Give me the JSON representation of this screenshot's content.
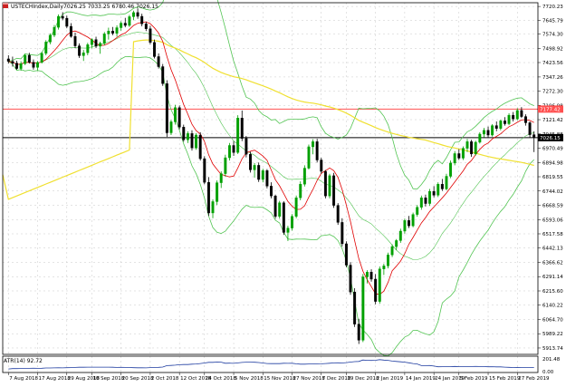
{
  "window": {
    "symbol_line": "USTECHIndex,Daily",
    "ohlc_line": "7026.25 7033.25 6780.46 7026.15"
  },
  "price_tags": {
    "resistance": "7177.42",
    "current": "7026.15"
  },
  "y_ticks": [
    "7720.23",
    "7645.79",
    "7574.30",
    "7498.92",
    "7423.56",
    "7347.26",
    "7272.30",
    "7196.98",
    "7121.42",
    "7045.88",
    "6970.49",
    "6894.98",
    "6819.55",
    "6744.02",
    "6668.59",
    "6593.06",
    "6517.58",
    "6442.13",
    "6366.62",
    "6291.14",
    "6215.60",
    "6140.22",
    "6064.70",
    "5989.22",
    "5913.74"
  ],
  "x_ticks": [
    "7 Aug 2018",
    "17 Aug 2018",
    "29 Aug 2018",
    "10 Sep 2018",
    "20 Sep 2018",
    "2 Oct 2018",
    "12 Oct 2018",
    "24 Oct 2018",
    "5 Nov 2018",
    "15 Nov 2018",
    "27 Nov 2018",
    "7 Dec 2018",
    "19 Dec 2018",
    "2 Jan 2019",
    "14 Jan 2019",
    "24 Jan 2019",
    "5 Feb 2019",
    "15 Feb 2019",
    "27 Feb 2019"
  ],
  "indicator": {
    "label": "ATR(14) 92.72",
    "ticks": [
      "201.48",
      "0.00"
    ]
  },
  "colors": {
    "bull": "#00a000",
    "bear": "#000000",
    "bollinger": "#52c452",
    "ma_fast": "#e00000",
    "ma_slow": "#f0e030",
    "resistance": "#ff5050",
    "current": "#000000",
    "grid": "#c8c8c8",
    "atr": "#1e3ca0"
  },
  "chart_data": {
    "type": "candlestick",
    "title": "USTECHIndex,Daily",
    "ylim": [
      5880,
      7740
    ],
    "candles": [
      [
        7443,
        7462,
        7418,
        7430
      ],
      [
        7430,
        7455,
        7402,
        7420
      ],
      [
        7420,
        7433,
        7385,
        7392
      ],
      [
        7392,
        7430,
        7380,
        7418
      ],
      [
        7418,
        7470,
        7410,
        7462
      ],
      [
        7462,
        7475,
        7418,
        7425
      ],
      [
        7425,
        7440,
        7386,
        7398
      ],
      [
        7398,
        7432,
        7382,
        7424
      ],
      [
        7424,
        7480,
        7418,
        7472
      ],
      [
        7472,
        7542,
        7462,
        7532
      ],
      [
        7532,
        7578,
        7520,
        7568
      ],
      [
        7568,
        7622,
        7558,
        7610
      ],
      [
        7610,
        7678,
        7598,
        7668
      ],
      [
        7668,
        7690,
        7648,
        7658
      ],
      [
        7658,
        7672,
        7605,
        7615
      ],
      [
        7615,
        7632,
        7555,
        7562
      ],
      [
        7562,
        7582,
        7500,
        7512
      ],
      [
        7512,
        7525,
        7448,
        7460
      ],
      [
        7460,
        7490,
        7432,
        7475
      ],
      [
        7475,
        7528,
        7462,
        7518
      ],
      [
        7518,
        7552,
        7498,
        7545
      ],
      [
        7545,
        7560,
        7500,
        7510
      ],
      [
        7510,
        7534,
        7470,
        7525
      ],
      [
        7525,
        7585,
        7515,
        7575
      ],
      [
        7575,
        7608,
        7545,
        7590
      ],
      [
        7590,
        7612,
        7568,
        7578
      ],
      [
        7578,
        7620,
        7560,
        7608
      ],
      [
        7608,
        7642,
        7592,
        7632
      ],
      [
        7632,
        7660,
        7610,
        7620
      ],
      [
        7620,
        7676,
        7612,
        7666
      ],
      [
        7666,
        7698,
        7648,
        7688
      ],
      [
        7688,
        7710,
        7655,
        7668
      ],
      [
        7668,
        7682,
        7615,
        7628
      ],
      [
        7628,
        7640,
        7590,
        7602
      ],
      [
        7602,
        7618,
        7520,
        7530
      ],
      [
        7530,
        7545,
        7445,
        7455
      ],
      [
        7455,
        7472,
        7392,
        7402
      ],
      [
        7402,
        7416,
        7300,
        7312
      ],
      [
        7312,
        7330,
        7030,
        7052
      ],
      [
        7052,
        7120,
        7040,
        7110
      ],
      [
        7110,
        7200,
        7095,
        7185
      ],
      [
        7185,
        7196,
        7070,
        7082
      ],
      [
        7082,
        7095,
        7005,
        7015
      ],
      [
        7015,
        7060,
        6998,
        7048
      ],
      [
        7048,
        7065,
        6958,
        6972
      ],
      [
        6972,
        7050,
        6962,
        7040
      ],
      [
        7040,
        7055,
        6905,
        6915
      ],
      [
        6915,
        6928,
        6780,
        6790
      ],
      [
        6790,
        6818,
        6612,
        6628
      ],
      [
        6628,
        6700,
        6600,
        6688
      ],
      [
        6688,
        6800,
        6670,
        6788
      ],
      [
        6788,
        6848,
        6760,
        6836
      ],
      [
        6836,
        6936,
        6820,
        6920
      ],
      [
        6920,
        6998,
        6905,
        6985
      ],
      [
        6985,
        7008,
        6930,
        6948
      ],
      [
        6948,
        7145,
        6940,
        7130
      ],
      [
        7130,
        7170,
        7008,
        7022
      ],
      [
        7022,
        7035,
        6922,
        6938
      ],
      [
        6938,
        6952,
        6842,
        6856
      ],
      [
        6856,
        6892,
        6815,
        6880
      ],
      [
        6880,
        6895,
        6792,
        6805
      ],
      [
        6805,
        6862,
        6790,
        6852
      ],
      [
        6852,
        6860,
        6758,
        6770
      ],
      [
        6770,
        6790,
        6705,
        6718
      ],
      [
        6718,
        6725,
        6598,
        6610
      ],
      [
        6610,
        6692,
        6598,
        6682
      ],
      [
        6682,
        6690,
        6512,
        6525
      ],
      [
        6525,
        6560,
        6480,
        6548
      ],
      [
        6548,
        6622,
        6535,
        6610
      ],
      [
        6610,
        6720,
        6600,
        6708
      ],
      [
        6708,
        6795,
        6695,
        6780
      ],
      [
        6780,
        6880,
        6768,
        6865
      ],
      [
        6865,
        6990,
        6858,
        6978
      ],
      [
        6978,
        7018,
        6938,
        7005
      ],
      [
        7005,
        7020,
        6895,
        6908
      ],
      [
        6908,
        6920,
        6835,
        6848
      ],
      [
        6848,
        6855,
        6705,
        6718
      ],
      [
        6718,
        6835,
        6705,
        6825
      ],
      [
        6825,
        6840,
        6655,
        6668
      ],
      [
        6668,
        6680,
        6565,
        6578
      ],
      [
        6578,
        6600,
        6450,
        6465
      ],
      [
        6465,
        6478,
        6340,
        6352
      ],
      [
        6352,
        6368,
        6195,
        6210
      ],
      [
        6210,
        6230,
        6025,
        6040
      ],
      [
        6040,
        6068,
        5935,
        5955
      ],
      [
        5955,
        6305,
        5945,
        6290
      ],
      [
        6290,
        6325,
        6255,
        6315
      ],
      [
        6315,
        6330,
        6265,
        6278
      ],
      [
        6278,
        6305,
        6145,
        6160
      ],
      [
        6160,
        6345,
        6148,
        6332
      ],
      [
        6332,
        6360,
        6300,
        6348
      ],
      [
        6348,
        6418,
        6335,
        6406
      ],
      [
        6406,
        6462,
        6395,
        6450
      ],
      [
        6450,
        6490,
        6432,
        6482
      ],
      [
        6482,
        6545,
        6470,
        6532
      ],
      [
        6532,
        6598,
        6518,
        6588
      ],
      [
        6588,
        6612,
        6548,
        6560
      ],
      [
        6560,
        6630,
        6552,
        6620
      ],
      [
        6620,
        6670,
        6608,
        6658
      ],
      [
        6658,
        6720,
        6645,
        6708
      ],
      [
        6708,
        6725,
        6662,
        6678
      ],
      [
        6678,
        6755,
        6665,
        6742
      ],
      [
        6742,
        6770,
        6710,
        6722
      ],
      [
        6722,
        6790,
        6712,
        6780
      ],
      [
        6780,
        6808,
        6745,
        6755
      ],
      [
        6755,
        6835,
        6748,
        6822
      ],
      [
        6822,
        6905,
        6812,
        6892
      ],
      [
        6892,
        6955,
        6880,
        6942
      ],
      [
        6942,
        6965,
        6908,
        6918
      ],
      [
        6918,
        6980,
        6908,
        6970
      ],
      [
        6970,
        7020,
        6950,
        7005
      ],
      [
        7005,
        7015,
        6925,
        6940
      ],
      [
        6940,
        7010,
        6932,
        7002
      ],
      [
        7002,
        7055,
        6995,
        7045
      ],
      [
        7045,
        7078,
        7028,
        7065
      ],
      [
        7065,
        7085,
        7028,
        7040
      ],
      [
        7040,
        7098,
        7032,
        7090
      ],
      [
        7090,
        7112,
        7060,
        7075
      ],
      [
        7075,
        7122,
        7065,
        7115
      ],
      [
        7115,
        7135,
        7090,
        7100
      ],
      [
        7100,
        7155,
        7092,
        7145
      ],
      [
        7145,
        7162,
        7112,
        7125
      ],
      [
        7125,
        7182,
        7118,
        7170
      ],
      [
        7170,
        7188,
        7130,
        7138
      ],
      [
        7138,
        7150,
        7090,
        7105
      ],
      [
        7105,
        7112,
        7028,
        7042
      ],
      [
        7042,
        7060,
        6950,
        7026
      ]
    ],
    "y_ticks": [
      7720.23,
      7645.79,
      7574.3,
      7498.92,
      7423.56,
      7347.26,
      7272.3,
      7196.98,
      7121.42,
      7045.88,
      6970.49,
      6894.98,
      6819.55,
      6744.02,
      6668.59,
      6593.06,
      6517.58,
      6442.13,
      6366.62,
      6291.14,
      6215.6,
      6140.22,
      6064.7,
      5989.22,
      5913.74
    ],
    "horizontal_lines": [
      {
        "value": 7177.42,
        "color": "#ff5050"
      },
      {
        "value": 7026.15,
        "color": "#000000"
      }
    ],
    "overlays": [
      "Bollinger Bands",
      "moving average (red)",
      "moving average (yellow)"
    ],
    "indicator": {
      "name": "ATR(14)",
      "last": 92.72,
      "ylim": [
        0,
        201.48
      ]
    }
  }
}
